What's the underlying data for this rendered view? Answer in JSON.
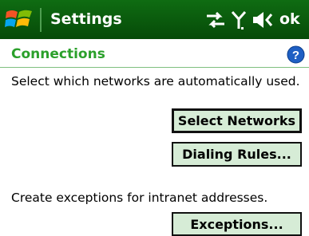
{
  "titlebar": {
    "title": "Settings",
    "ok_label": "ok",
    "status_icons": [
      "data-connection-icon",
      "signal-strength-icon",
      "volume-muted-icon"
    ]
  },
  "header": {
    "title": "Connections"
  },
  "content": {
    "networks_description": "Select which networks are automatically used.",
    "select_networks_label": "Select Networks",
    "dialing_rules_label": "Dialing Rules...",
    "exceptions_description": "Create exceptions for intranet addresses.",
    "exceptions_label": "Exceptions..."
  },
  "colors": {
    "titlebar": "#0a5c0c",
    "header_text": "#2ba02b",
    "button_fill": "#d6ecd6",
    "help_icon": "#1e5fc4"
  }
}
